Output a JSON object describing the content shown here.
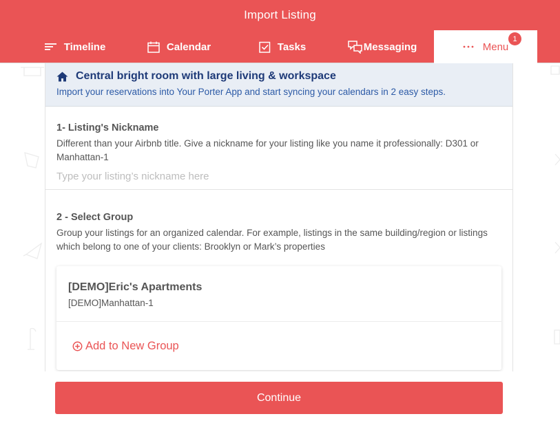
{
  "header": {
    "title": "Import Listing",
    "nav": [
      {
        "label": "Timeline",
        "icon": "timeline-icon"
      },
      {
        "label": "Calendar",
        "icon": "calendar-icon"
      },
      {
        "label": "Tasks",
        "icon": "tasks-icon"
      },
      {
        "label": "Messaging",
        "icon": "messaging-icon"
      },
      {
        "label": "Menu",
        "icon": "more-dots-icon",
        "badge": "1",
        "active": true
      }
    ]
  },
  "listing": {
    "title": "Central bright room with large living & workspace",
    "subtitle": "Import your reservations into Your Porter App and start syncing your calendars in 2 easy steps.",
    "icon": "home-icon"
  },
  "step1": {
    "title": "1- Listing's Nickname",
    "description": "Different than your Airbnb title. Give a nickname for your listing like you name it professionally: D301 or Manhattan-1",
    "input_value": "",
    "placeholder": "Type your listing’s nickname here"
  },
  "step2": {
    "title": "2 - Select Group",
    "description": "Group your listings for an organized calendar. For example, listings in the same building/region or listings which belong to one of your clients: Brooklyn or Mark’s properties",
    "groups": [
      {
        "name": "[DEMO]Eric's Apartments",
        "listings": "[DEMO]Manhattan-1"
      }
    ],
    "add_group_label": "Add to New Group",
    "add_group_icon": "plus-circle-icon"
  },
  "continue_label": "Continue",
  "colors": {
    "brand": "#ea5455",
    "banner_bg": "#e9eef5",
    "banner_title": "#1e3a78",
    "banner_text": "#2c5aa6"
  }
}
